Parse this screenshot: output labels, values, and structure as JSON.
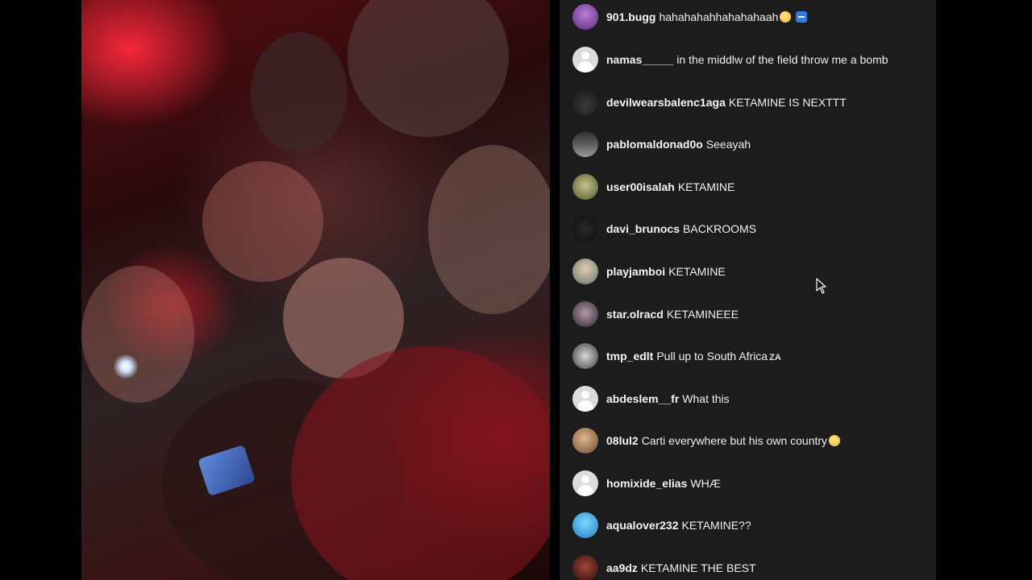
{
  "comments": [
    {
      "username": "901.bugg",
      "text": "hahahahahhahahahaah",
      "emoji": "face-emoji",
      "extra_icon": "minus-emoji",
      "avatar": "purple-avatar"
    },
    {
      "username": "namas_____",
      "text": "in the middlw of the field throw me a bomb",
      "avatar": "default-avatar"
    },
    {
      "username": "devilwearsbalenc1aga",
      "text": "KETAMINE IS NEXTTT",
      "avatar": "dark-figure-avatar"
    },
    {
      "username": "pablomaldonad0o",
      "text": "Seeayah",
      "avatar": "car-avatar"
    },
    {
      "username": "user00isalah",
      "text": "KETAMINE",
      "avatar": "green-avatar"
    },
    {
      "username": "davi_brunocs",
      "text": "BACKROOMS",
      "avatar": "dark-avatar"
    },
    {
      "username": "playjamboi",
      "text": "KETAMINE",
      "avatar": "portrait-avatar"
    },
    {
      "username": "star.olracd",
      "text": "KETAMINEEE",
      "avatar": "dark-portrait-avatar"
    },
    {
      "username": "tmp_edlt",
      "text": "Pull up to South Africa",
      "suffix": "ZA",
      "avatar": "bw-avatar"
    },
    {
      "username": "abdeslem__fr",
      "text": "What this",
      "avatar": "default-avatar"
    },
    {
      "username": "08lul2",
      "text": "Carti everywhere but his own country",
      "emoji": "face-emoji",
      "avatar": "brown-avatar"
    },
    {
      "username": "homixide_elias",
      "text": "WHÆ",
      "avatar": "default-avatar"
    },
    {
      "username": "aqualover232",
      "text": "KETAMINE??",
      "avatar": "blue-avatar"
    },
    {
      "username": "aa9dz",
      "text": "KETAMINE THE BEST",
      "avatar": "red-avatar"
    }
  ],
  "colors": {
    "comments_background": "#1c1c1c",
    "text": "#f2f2f2",
    "page_background": "#000000"
  },
  "icons": {
    "cursor": "mouse-pointer-icon"
  }
}
